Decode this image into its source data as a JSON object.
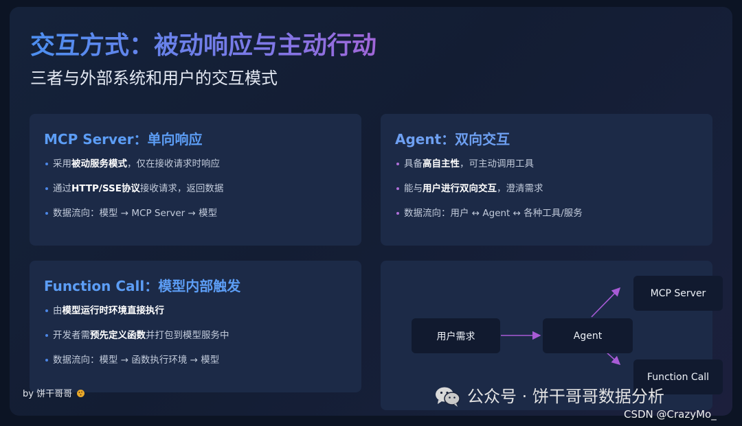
{
  "title": "交互方式：被动响应与主动行动",
  "subtitle": "三者与外部系统和用户的交互模式",
  "cards": {
    "mcp": {
      "title": "MCP Server：单向响应",
      "b1": {
        "pre": "采用",
        "bold": "被动服务模式",
        "post": "，仅在接收请求时响应"
      },
      "b2": {
        "pre": "通过",
        "bold": "HTTP/SSE协议",
        "post": "接收请求，返回数据"
      },
      "b3": {
        "text": "数据流向：模型 → MCP Server → 模型"
      }
    },
    "agent": {
      "title": "Agent：双向交互",
      "b1": {
        "pre": "具备",
        "bold": "高自主性",
        "post": "，可主动调用工具"
      },
      "b2": {
        "pre": "能与",
        "bold": "用户进行双向交互",
        "post": "，澄清需求"
      },
      "b3": {
        "text": "数据流向：用户 ↔ Agent ↔ 各种工具/服务"
      }
    },
    "function": {
      "title": "Function Call：模型内部触发",
      "b1": {
        "pre": "由",
        "bold": "模型运行时环境直接执行",
        "post": ""
      },
      "b2": {
        "pre": "开发者需",
        "bold": "预先定义函数",
        "post": "并打包到模型服务中"
      },
      "b3": {
        "text": "数据流向：模型 → 函数执行环境 → 模型"
      }
    }
  },
  "diagram": {
    "nodes": {
      "user": "用户需求",
      "agent": "Agent",
      "mcp": "MCP Server",
      "function": "Function Call"
    },
    "arrow_color": "#a85bd6"
  },
  "byline": "by 饼干哥哥",
  "watermark": "公众号 · 饼干哥哥数据分析",
  "csdn": "CSDN @CrazyMo_"
}
